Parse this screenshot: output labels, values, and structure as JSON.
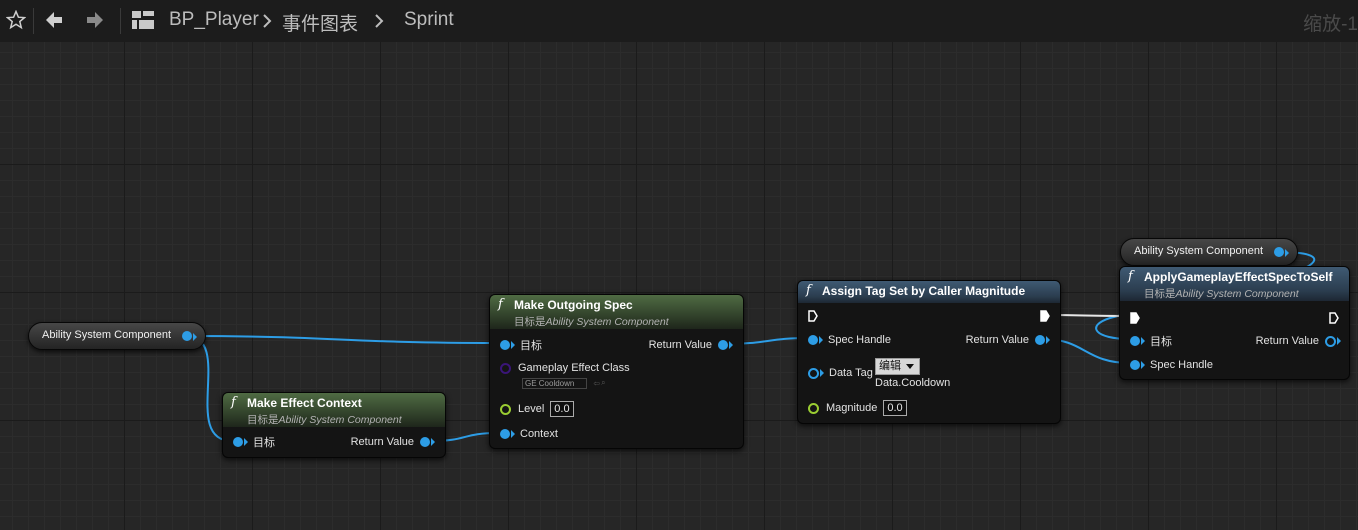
{
  "toolbar": {
    "breadcrumb": [
      "BP_Player",
      "事件图表",
      "Sprint"
    ],
    "zoom_label": "缩放-1"
  },
  "icons": {
    "favorite": "star-outline-icon",
    "back": "arrow-left-icon",
    "forward": "arrow-right-icon",
    "blueprint": "blueprint-grid-icon",
    "breadcrumb_sep": "chevron-right-icon"
  },
  "nodes": {
    "asc_var_left": {
      "label": "Ability System Component"
    },
    "asc_var_right": {
      "label": "Ability System Component"
    },
    "make_effect_context": {
      "title": "Make Effect Context",
      "subtitle_prefix": "目标是",
      "subtitle_target": "Ability System Component",
      "pins": {
        "target": "目标",
        "return_value": "Return Value"
      }
    },
    "make_outgoing_spec": {
      "title": "Make Outgoing Spec",
      "subtitle_prefix": "目标是",
      "subtitle_target": "Ability System Component",
      "pins": {
        "target": "目标",
        "return_value": "Return Value",
        "gameplay_effect_class": "Gameplay Effect Class",
        "gameplay_effect_class_value": "GE Cooldown",
        "level": "Level",
        "level_value": "0.0",
        "context": "Context"
      }
    },
    "assign_tag_set": {
      "title": "Assign Tag Set by Caller Magnitude",
      "pins": {
        "spec_handle": "Spec Handle",
        "return_value": "Return Value",
        "data_tag": "Data Tag",
        "data_tag_edit": "编辑",
        "data_tag_value": "Data.Cooldown",
        "magnitude": "Magnitude",
        "magnitude_value": "0.0"
      }
    },
    "apply_spec_to_self": {
      "title": "ApplyGameplayEffectSpecToSelf",
      "subtitle_prefix": "目标是",
      "subtitle_target": "Ability System Component",
      "pins": {
        "target": "目标",
        "return_value": "Return Value",
        "spec_handle": "Spec Handle"
      }
    }
  },
  "colors": {
    "pin_struct": "#2d9de6",
    "pin_float": "#9acd32",
    "pin_class": "#3a1578",
    "exec_wire": "#ffffff",
    "pure_header": "#4f6b43",
    "callable_header": "#3f5a73"
  }
}
